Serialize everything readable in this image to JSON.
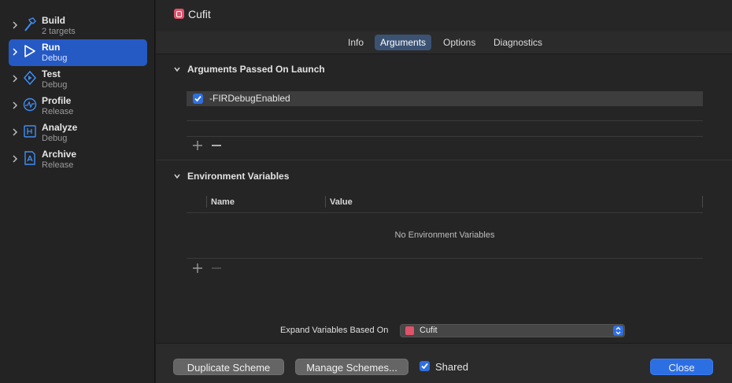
{
  "sidebar": {
    "actions": [
      {
        "title": "Build",
        "subtitle": "2 targets",
        "icon": "hammer-icon"
      },
      {
        "title": "Run",
        "subtitle": "Debug",
        "icon": "play-icon"
      },
      {
        "title": "Test",
        "subtitle": "Debug",
        "icon": "test-diamond-icon"
      },
      {
        "title": "Profile",
        "subtitle": "Release",
        "icon": "gauge-icon"
      },
      {
        "title": "Analyze",
        "subtitle": "Debug",
        "icon": "analyze-icon"
      },
      {
        "title": "Archive",
        "subtitle": "Release",
        "icon": "archive-icon"
      }
    ],
    "selected": "Run"
  },
  "header": {
    "scheme_name": "Cufit"
  },
  "tabs": [
    {
      "label": "Info",
      "active": false
    },
    {
      "label": "Arguments",
      "active": true
    },
    {
      "label": "Options",
      "active": false
    },
    {
      "label": "Diagnostics",
      "active": false
    }
  ],
  "arguments": {
    "title": "Arguments Passed On Launch",
    "items": [
      {
        "value": "-FIRDebugEnabled",
        "checked": true
      }
    ]
  },
  "environment": {
    "title": "Environment Variables",
    "columns": [
      "Name",
      "Value"
    ],
    "empty_text": "No Environment Variables"
  },
  "expand": {
    "label": "Expand Variables Based On",
    "value": "Cufit"
  },
  "footer": {
    "duplicate_label": "Duplicate Scheme",
    "manage_label": "Manage Schemes...",
    "shared_label": "Shared",
    "shared_checked": true,
    "close_label": "Close"
  },
  "colors": {
    "accent": "#2c6fe3",
    "selection": "#2559c4",
    "scheme_icon": "#e0526a"
  }
}
